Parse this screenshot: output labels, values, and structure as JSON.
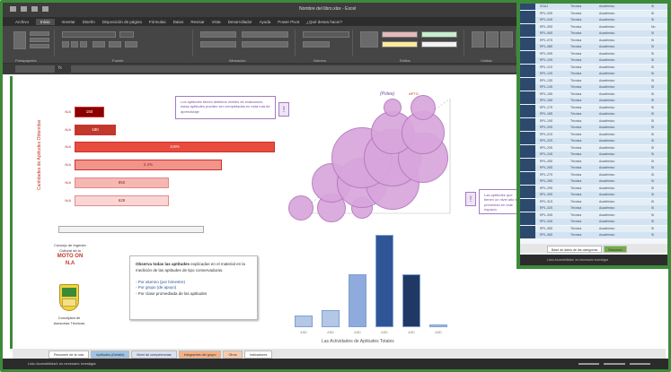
{
  "window": {
    "title": "Nombre del libro.xlsx - Excel"
  },
  "ribbon": {
    "tabs": [
      {
        "label": "Archivo"
      },
      {
        "label": "Inicio"
      },
      {
        "label": "Insertar"
      },
      {
        "label": "Diseño"
      },
      {
        "label": "Disposición de página"
      },
      {
        "label": "Fórmulas"
      },
      {
        "label": "Datos"
      },
      {
        "label": "Revisar"
      },
      {
        "label": "Vista"
      },
      {
        "label": "Desarrollador"
      },
      {
        "label": "Ayuda"
      },
      {
        "label": "Power Pivot"
      },
      {
        "label": "¿Qué desea hacer?"
      }
    ],
    "groups": [
      "Portapapeles",
      "Fuente",
      "Alineación",
      "Número",
      "Estilos",
      "Celdas",
      "Edición"
    ]
  },
  "chart_data": [
    {
      "type": "bar",
      "orientation": "horizontal",
      "categories": [
        "N/A",
        "N/A",
        "N/A",
        "N/A",
        "N/A",
        "N/A"
      ],
      "values": [
        50,
        80,
        500,
        360,
        220,
        220
      ],
      "value_labels": [
        "150",
        "180",
        "3.6%",
        "2.4%",
        "850",
        "628"
      ],
      "colors": [
        "#8b0000",
        "#c0392b",
        "#e74c3c",
        "#f1948a",
        "#f5b7b1",
        "#f9d6d3"
      ]
    },
    {
      "type": "scatter",
      "points": [
        {
          "x": 1,
          "y": 1,
          "size": 14
        },
        {
          "x": 2,
          "y": 1,
          "size": 16
        },
        {
          "x": 3,
          "y": 1,
          "size": 12
        },
        {
          "x": 2,
          "y": 2,
          "size": 22
        },
        {
          "x": 3,
          "y": 2,
          "size": 28
        },
        {
          "x": 4,
          "y": 2,
          "size": 30
        },
        {
          "x": 3,
          "y": 3,
          "size": 34
        },
        {
          "x": 4,
          "y": 3,
          "size": 32
        },
        {
          "x": 5,
          "y": 3,
          "size": 28
        },
        {
          "x": 4,
          "y": 4,
          "size": 24
        },
        {
          "x": 5,
          "y": 4,
          "size": 24
        },
        {
          "x": 5,
          "y": 5,
          "size": 14
        },
        {
          "x": 4,
          "y": 5,
          "size": 10
        }
      ]
    },
    {
      "type": "bar",
      "title": "Las Actividades de Aptitudes Totales",
      "categories": [
        "ASD",
        "ASD",
        "ASD",
        "ASD",
        "ASD",
        "ASD"
      ],
      "values": [
        12,
        18,
        55,
        95,
        55,
        3
      ],
      "colors": [
        "#b4c7e7",
        "#b4c7e7",
        "#8faadc",
        "#2f5597",
        "#203864",
        "#9dc3e6"
      ]
    }
  ],
  "main": {
    "vertical_title": "Cantidades de Aptitudes Obtenidas",
    "callout_top": {
      "text": "Los aptitudes tienen distintos niveles de evaluación, estas aptitudes pueden ser completadas en esta ruta de aprendizaje",
      "icon": "bulb-icon"
    },
    "callout_right": {
      "text": "Las aptitudes que tienen un nivel alto se presentan en este espacio",
      "icon": "bulb-icon"
    },
    "axis_top_left": "(Polea)",
    "axis_top_right": "APTO",
    "logo": {
      "line1": "Concejo de Ingenier",
      "line2": "Cultural de la",
      "red_line1": "MOTO ON",
      "red_line2": "N.A",
      "bottom1": "Concejalía de",
      "bottom2": "Asesorías Técnicas"
    },
    "note": {
      "bold": "Observa todas las aptitudes",
      "text": "explicadas en el material en la medición de las aptitudes de tipo conservaduras.",
      "lines": [
        "- Por alumno (por bimestre)",
        "- Por grupo (de apoyo)",
        "- Por clase promediada de las aptitudes"
      ]
    }
  },
  "sheet_tabs": [
    {
      "label": "Resumen de la ruta",
      "color": "#ffffff"
    },
    {
      "label": "Aptitudes (Detalle)",
      "color": "#9dc3e6"
    },
    {
      "label": "Nivel de competencias",
      "color": "#d9e2f3"
    },
    {
      "label": "Integrantes del grupo",
      "color": "#f4b183"
    },
    {
      "label": "Otros",
      "color": "#f8cbad"
    },
    {
      "label": "Indicadores",
      "color": "#ffffff"
    }
  ],
  "status": {
    "text": "Listo   Accesibilidad: es necesario investigar"
  },
  "overlay": {
    "rows": [
      {
        "c1": "SGAJ",
        "c2": "Técnica",
        "c3": "Académico",
        "c4": "Si"
      },
      {
        "c1": "RPL-03S",
        "c2": "Técnica",
        "c3": "Académico",
        "c4": "Si"
      },
      {
        "c1": "RPL-04S",
        "c2": "Técnica",
        "c3": "Académico",
        "c4": "Si"
      },
      {
        "c1": "RPL-05S",
        "c2": "Técnica",
        "c3": "Académico",
        "c4": "No"
      },
      {
        "c1": "RPL-06S",
        "c2": "Técnica",
        "c3": "Académico",
        "c4": "Si"
      },
      {
        "c1": "RPL-07S",
        "c2": "Técnica",
        "c3": "Académico",
        "c4": "Si"
      },
      {
        "c1": "RPL-08S",
        "c2": "Técnica",
        "c3": "Académico",
        "c4": "Si"
      },
      {
        "c1": "RPL-09S",
        "c2": "Técnica",
        "c3": "Académico",
        "c4": "Si"
      },
      {
        "c1": "RPL-10S",
        "c2": "Técnica",
        "c3": "Académico",
        "c4": "Si"
      },
      {
        "c1": "RPL-11S",
        "c2": "Técnica",
        "c3": "Académico",
        "c4": "Si"
      },
      {
        "c1": "RPL-12S",
        "c2": "Técnica",
        "c3": "Académico",
        "c4": "Si"
      },
      {
        "c1": "RPL-13S",
        "c2": "Técnica",
        "c3": "Académico",
        "c4": "Si"
      },
      {
        "c1": "RPL-14S",
        "c2": "Técnica",
        "c3": "Académico",
        "c4": "Si"
      },
      {
        "c1": "RPL-15S",
        "c2": "Técnica",
        "c3": "Académico",
        "c4": "Si"
      },
      {
        "c1": "RPL-16S",
        "c2": "Técnica",
        "c3": "Académico",
        "c4": "Si"
      },
      {
        "c1": "RPL-17S",
        "c2": "Técnica",
        "c3": "Académico",
        "c4": "Si"
      },
      {
        "c1": "RPL-18S",
        "c2": "Técnica",
        "c3": "Académico",
        "c4": "Si"
      },
      {
        "c1": "RPL-19S",
        "c2": "Técnica",
        "c3": "Académico",
        "c4": "Si"
      },
      {
        "c1": "RPL-20S",
        "c2": "Técnica",
        "c3": "Académico",
        "c4": "Si"
      },
      {
        "c1": "RPL-21S",
        "c2": "Técnica",
        "c3": "Académico",
        "c4": "Si"
      },
      {
        "c1": "RPL-22S",
        "c2": "Técnica",
        "c3": "Académico",
        "c4": "Si"
      },
      {
        "c1": "RPL-23S",
        "c2": "Técnica",
        "c3": "Académico",
        "c4": "Si"
      },
      {
        "c1": "RPL-24S",
        "c2": "Técnica",
        "c3": "Académico",
        "c4": "Si"
      },
      {
        "c1": "RPL-25S",
        "c2": "Técnica",
        "c3": "Académico",
        "c4": "Si"
      },
      {
        "c1": "RPL-26S",
        "c2": "Técnica",
        "c3": "Académico",
        "c4": "Si"
      },
      {
        "c1": "RPL-27S",
        "c2": "Técnica",
        "c3": "Académico",
        "c4": "Si"
      },
      {
        "c1": "RPL-28S",
        "c2": "Técnica",
        "c3": "Académico",
        "c4": "Si"
      },
      {
        "c1": "RPL-29S",
        "c2": "Técnica",
        "c3": "Académico",
        "c4": "Si"
      },
      {
        "c1": "RPL-30S",
        "c2": "Técnica",
        "c3": "Académico",
        "c4": "Si"
      },
      {
        "c1": "RPL-31S",
        "c2": "Técnica",
        "c3": "Académico",
        "c4": "Si"
      },
      {
        "c1": "RPL-32S",
        "c2": "Técnica",
        "c3": "Académico",
        "c4": "Si"
      },
      {
        "c1": "RPL-33S",
        "c2": "Técnica",
        "c3": "Académico",
        "c4": "Si"
      },
      {
        "c1": "RPL-34S",
        "c2": "Técnica",
        "c3": "Académico",
        "c4": "Si"
      },
      {
        "c1": "RPL-35S",
        "c2": "Técnica",
        "c3": "Académico",
        "c4": "Si"
      },
      {
        "c1": "RPL-36S",
        "c2": "Técnica",
        "c3": "Académico",
        "c4": "Si"
      }
    ],
    "tabs": [
      {
        "label": "Base de datos de las categorías"
      },
      {
        "label": "Resumen"
      }
    ],
    "status": "Listo   Accesibilidad: es necesario investigar"
  }
}
